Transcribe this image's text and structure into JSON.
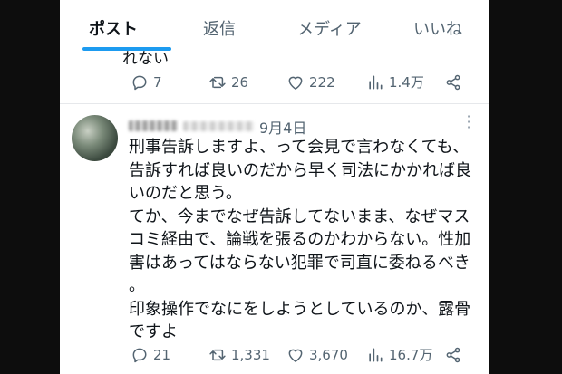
{
  "tabs": [
    {
      "label": "ポスト",
      "active": true
    },
    {
      "label": "返信",
      "active": false
    },
    {
      "label": "メディア",
      "active": false
    },
    {
      "label": "いいね",
      "active": false
    }
  ],
  "prev_post": {
    "cut_text": "れない",
    "replies": "7",
    "reposts": "26",
    "likes": "222",
    "views": "1.4万"
  },
  "post": {
    "date": "9月4日",
    "lines": [
      "刑事告訴しますよ、って会見で言わなくても、",
      "告訴すれば良いのだから早く司法にかかれば良",
      "いのだと思う。",
      "てか、今までなぜ告訴してないまま、なぜマス",
      "コミ経由で、論戦を張るのかわからない。性加",
      "害はあってはならない犯罪で司直に委ねるべき",
      "。",
      "印象操作でなにをしようとしているのか、露骨",
      "ですよ"
    ],
    "replies": "21",
    "reposts": "1,331",
    "likes": "3,670",
    "views": "16.7万"
  },
  "icons": {
    "reply": "reply-icon",
    "repost": "repost-icon",
    "like": "heart-icon",
    "views": "views-chart-icon",
    "share": "share-icon",
    "more": "more-vertical-icon"
  },
  "colors": {
    "accent": "#1d9bf0",
    "text": "#0f1419",
    "muted": "#536471",
    "background": "#ffffff",
    "frame": "#0d0d0d"
  }
}
